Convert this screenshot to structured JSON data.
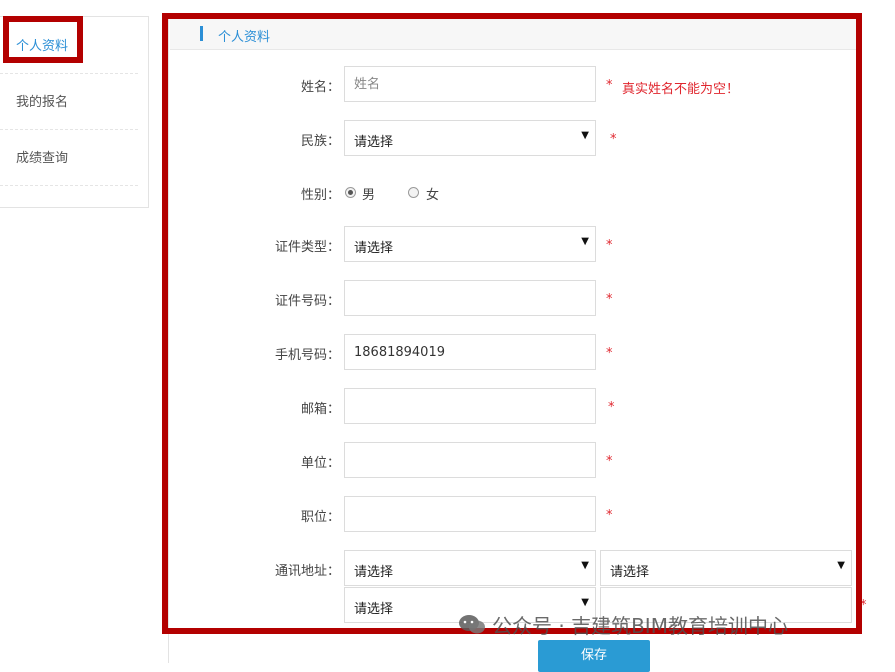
{
  "sidebar": {
    "items": [
      {
        "label": "个人资料"
      },
      {
        "label": "我的报名"
      },
      {
        "label": "成绩查询"
      }
    ]
  },
  "panel": {
    "title": "个人资料"
  },
  "form": {
    "name": {
      "label": "姓名：",
      "placeholder": "姓名",
      "error": "真实姓名不能为空！"
    },
    "ethnicity": {
      "label": "民族：",
      "value": "请选择"
    },
    "gender": {
      "label": "性别：",
      "options": [
        "男",
        "女"
      ],
      "selected": "男"
    },
    "id_type": {
      "label": "证件类型：",
      "value": "请选择"
    },
    "id_number": {
      "label": "证件号码：",
      "value": ""
    },
    "phone": {
      "label": "手机号码：",
      "value": "18681894019"
    },
    "email": {
      "label": "邮箱：",
      "value": ""
    },
    "company": {
      "label": "单位：",
      "value": ""
    },
    "position": {
      "label": "职位：",
      "value": ""
    },
    "address": {
      "label": "通讯地址：",
      "province": "请选择",
      "city": "请选择",
      "district": "请选择"
    },
    "required_mark": "*",
    "dropdown_caret": "▼"
  },
  "actions": {
    "save_label": "保存"
  },
  "watermark": {
    "text": "公众号 · 吉建筑BIM教育培训中心"
  },
  "colors": {
    "accent": "#2b8fd6",
    "error": "#e0262e",
    "highlight": "#b30000",
    "button": "#2a9bd4"
  }
}
